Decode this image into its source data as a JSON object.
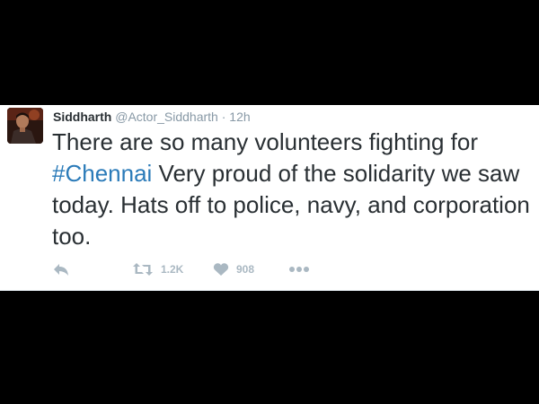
{
  "tweet": {
    "author": {
      "display_name": "Siddharth",
      "handle": "@Actor_Siddharth",
      "separator": "·",
      "timestamp": "12h"
    },
    "text_before": "There are so many volunteers fighting for ",
    "hashtag": "#Chennai",
    "text_after": " Very proud of the solidarity we saw today. Hats off to police, navy, and corporation too.",
    "actions": {
      "reply_icon": "reply-icon",
      "retweet_icon": "retweet-icon",
      "retweet_count": "1.2K",
      "like_icon": "heart-icon",
      "like_count": "908",
      "more_icon": "more-icon"
    }
  },
  "colors": {
    "background": "#000000",
    "card": "#ffffff",
    "text": "#292f33",
    "muted": "#8899a6",
    "link": "#2b7bb9",
    "action": "#aab8c2"
  }
}
